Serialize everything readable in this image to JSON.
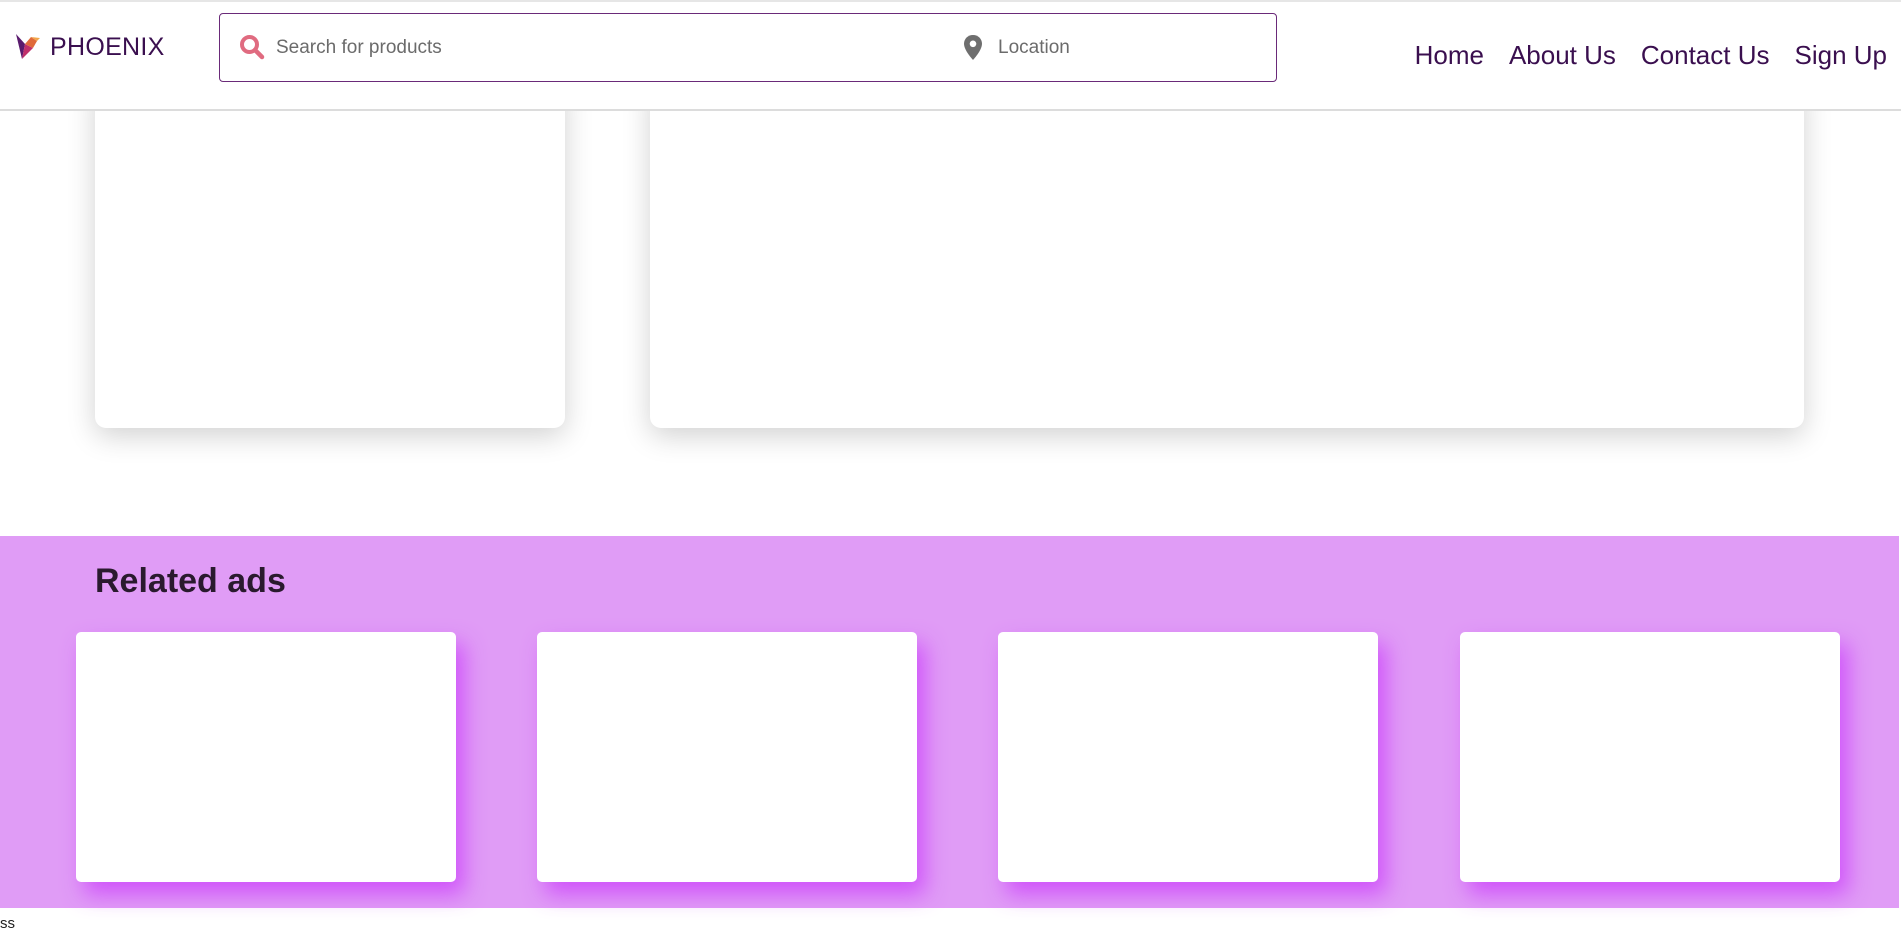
{
  "header": {
    "logo_text": "PHOENIX",
    "logo_icon": "phoenix-bird-icon",
    "search": {
      "placeholder": "Search for products",
      "value": "",
      "icon": "search-icon",
      "icon_color": "#e06b80"
    },
    "location": {
      "placeholder": "Location",
      "value": "",
      "icon": "location-pin-icon"
    },
    "nav": [
      {
        "label": "Home"
      },
      {
        "label": "About Us"
      },
      {
        "label": "Contact Us"
      },
      {
        "label": "Sign Up"
      }
    ]
  },
  "related": {
    "title": "Related ads",
    "background_color": "#e09cf6",
    "ad_count": 4
  },
  "footer": {
    "text": "ss"
  },
  "colors": {
    "brand": "#3a0f4f",
    "search_border": "#6a2a79",
    "card_glow": "#cd46fa"
  }
}
